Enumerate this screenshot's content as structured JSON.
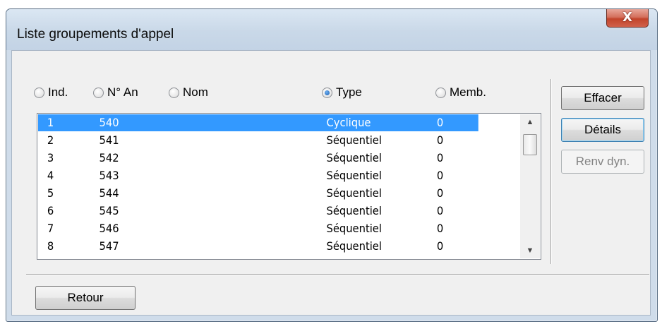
{
  "window": {
    "title": "Liste groupements d'appel",
    "close_glyph": "X"
  },
  "sort_options": [
    {
      "label": "Ind.",
      "checked": false
    },
    {
      "label": "N° An",
      "checked": false
    },
    {
      "label": "Nom",
      "checked": false
    },
    {
      "label": "Type",
      "checked": true
    },
    {
      "label": "Memb.",
      "checked": false
    }
  ],
  "list": {
    "rows": [
      {
        "ind": "1",
        "num": "540",
        "type": "Cyclique",
        "memb": "0",
        "selected": true
      },
      {
        "ind": "2",
        "num": "541",
        "type": "Séquentiel",
        "memb": "0",
        "selected": false
      },
      {
        "ind": "3",
        "num": "542",
        "type": "Séquentiel",
        "memb": "0",
        "selected": false
      },
      {
        "ind": "4",
        "num": "543",
        "type": "Séquentiel",
        "memb": "0",
        "selected": false
      },
      {
        "ind": "5",
        "num": "544",
        "type": "Séquentiel",
        "memb": "0",
        "selected": false
      },
      {
        "ind": "6",
        "num": "545",
        "type": "Séquentiel",
        "memb": "0",
        "selected": false
      },
      {
        "ind": "7",
        "num": "546",
        "type": "Séquentiel",
        "memb": "0",
        "selected": false
      },
      {
        "ind": "8",
        "num": "547",
        "type": "Séquentiel",
        "memb": "0",
        "selected": false
      }
    ]
  },
  "buttons": {
    "effacer": "Effacer",
    "details": "Détails",
    "renv_dyn": "Renv dyn.",
    "retour": "Retour"
  },
  "icons": {
    "scroll_up": "scroll-up-arrow-icon",
    "scroll_down": "scroll-down-arrow-icon",
    "close": "close-icon"
  },
  "colors": {
    "selection": "#3399ff",
    "close_button": "#c7472e"
  }
}
